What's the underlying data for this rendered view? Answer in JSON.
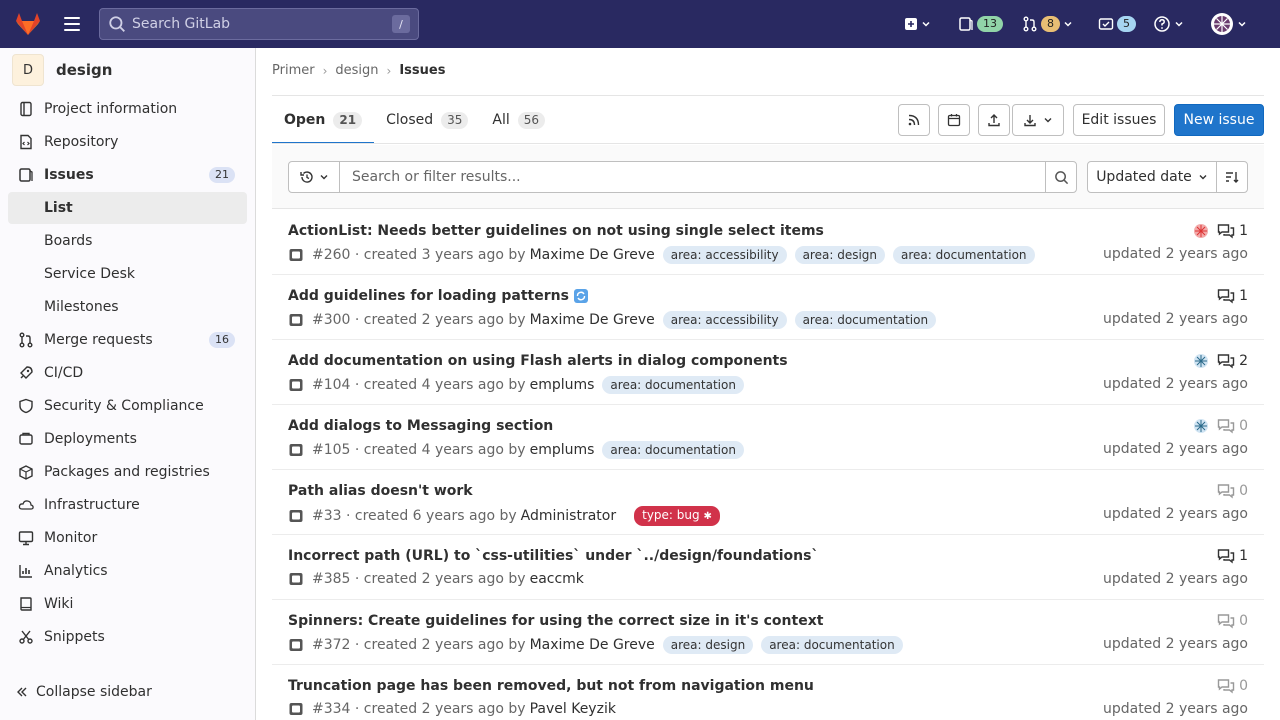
{
  "topbar": {
    "search_placeholder": "Search GitLab",
    "search_shortcut": "/",
    "issues_count": "13",
    "merge_requests_count": "8",
    "todos_count": "5"
  },
  "sidebar": {
    "project_initial": "D",
    "project_name": "design",
    "items": [
      {
        "label": "Project information"
      },
      {
        "label": "Repository"
      },
      {
        "label": "Issues",
        "count": "21"
      },
      {
        "label": "List"
      },
      {
        "label": "Boards"
      },
      {
        "label": "Service Desk"
      },
      {
        "label": "Milestones"
      },
      {
        "label": "Merge requests",
        "count": "16"
      },
      {
        "label": "CI/CD"
      },
      {
        "label": "Security & Compliance"
      },
      {
        "label": "Deployments"
      },
      {
        "label": "Packages and registries"
      },
      {
        "label": "Infrastructure"
      },
      {
        "label": "Monitor"
      },
      {
        "label": "Analytics"
      },
      {
        "label": "Wiki"
      },
      {
        "label": "Snippets"
      }
    ],
    "collapse_label": "Collapse sidebar"
  },
  "breadcrumb": [
    "Primer",
    "design",
    "Issues"
  ],
  "tabs": [
    {
      "label": "Open",
      "count": "21"
    },
    {
      "label": "Closed",
      "count": "35"
    },
    {
      "label": "All",
      "count": "56"
    }
  ],
  "actions": {
    "edit_issues": "Edit issues",
    "new_issue": "New issue"
  },
  "filter": {
    "placeholder": "Search or filter results...",
    "sort_label": "Updated date"
  },
  "issues": [
    {
      "title": "ActionList: Needs better guidelines on not using single select items",
      "meta": "#260 · created 3 years ago by",
      "author": "Maxime De Greve",
      "labels": [
        "area: accessibility",
        "area: design",
        "area: documentation"
      ],
      "comments": "1",
      "updated": "updated 2 years ago"
    },
    {
      "title": "Add guidelines for loading patterns",
      "meta": "#300 · created 2 years ago by",
      "author": "Maxime De Greve",
      "labels": [
        "area: accessibility",
        "area: documentation"
      ],
      "comments": "1",
      "updated": "updated 2 years ago"
    },
    {
      "title": "Add documentation on using Flash alerts in dialog components",
      "meta": "#104 · created 4 years ago by",
      "author": "emplums",
      "labels": [
        "area: documentation"
      ],
      "comments": "2",
      "updated": "updated 2 years ago"
    },
    {
      "title": "Add dialogs to Messaging section",
      "meta": "#105 · created 4 years ago by",
      "author": "emplums",
      "labels": [
        "area: documentation"
      ],
      "comments": "0",
      "updated": "updated 2 years ago"
    },
    {
      "title": "Path alias doesn't work",
      "meta": "#33 · created 6 years ago by",
      "author": "Administrator",
      "labels": [
        "type: bug"
      ],
      "comments": "0",
      "updated": "updated 2 years ago"
    },
    {
      "title": "Incorrect path (URL) to `css-utilities` under `../design/foundations`",
      "meta": "#385 · created 2 years ago by",
      "author": "eaccmk",
      "labels": [],
      "comments": "1",
      "updated": "updated 2 years ago"
    },
    {
      "title": "Spinners: Create guidelines for using the correct size in it's context",
      "meta": "#372 · created 2 years ago by",
      "author": "Maxime De Greve",
      "labels": [
        "area: design",
        "area: documentation"
      ],
      "comments": "0",
      "updated": "updated 2 years ago"
    },
    {
      "title": "Truncation page has been removed, but not from navigation menu",
      "meta": "#334 · created 2 years ago by",
      "author": "Pavel Keyzik",
      "labels": [],
      "comments": "0",
      "updated": "updated 2 years ago"
    }
  ]
}
